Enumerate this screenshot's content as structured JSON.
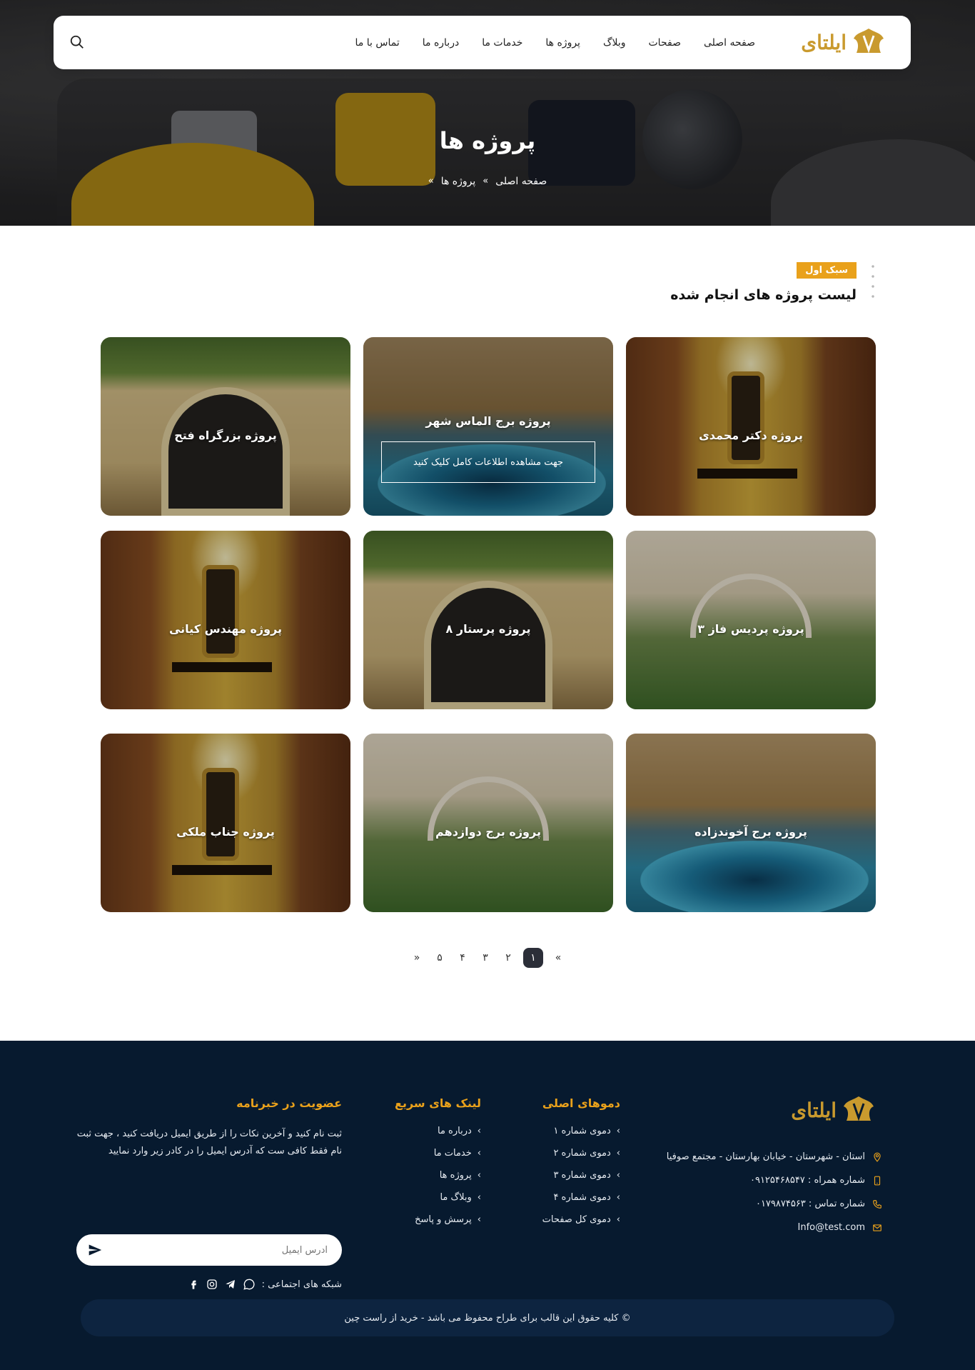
{
  "nav": {
    "logo_text": "ایلتای",
    "menu": [
      "صفحه اصلی",
      "صفحات",
      "وبلاگ",
      "پروژه ها",
      "خدمات ما",
      "درباره ما",
      "تماس با ما"
    ]
  },
  "hero": {
    "title": "پروژه ها",
    "breadcrumb": [
      "صفحه اصلی",
      "پروژه ها"
    ],
    "sep": "»"
  },
  "section": {
    "badge": "سبک اول",
    "title": "لیست پروژه های انجام شده"
  },
  "projects": [
    {
      "title": "پروژه دکتر محمدی",
      "scene": "mirror"
    },
    {
      "title": "پروژه برج الماس شهر",
      "scene": "pool",
      "button": "جهت مشاهده اطلاعات کامل کلیک کنید"
    },
    {
      "title": "پروژه بزرگراه فتح",
      "scene": "gate"
    },
    {
      "title": "پروژه پردیس فاز ۳",
      "scene": "garden"
    },
    {
      "title": "پروژه پرستار ۸",
      "scene": "gate"
    },
    {
      "title": "پروژه مهندس کیانی",
      "scene": "mirror"
    },
    {
      "title": "پروژه برج آخوندزاده",
      "scene": "pool"
    },
    {
      "title": "پروژه برج دوازدهم",
      "scene": "garden"
    },
    {
      "title": "پروژه جناب ملکی",
      "scene": "mirror"
    }
  ],
  "pagination": {
    "prev": "«",
    "pages": [
      "۱",
      "۲",
      "۳",
      "۴",
      "۵"
    ],
    "next": "»",
    "current": "۱"
  },
  "footer": {
    "logo_text": "ایلتای",
    "address": "استان - شهرستان - خیابان بهارستان - مجتمع صوفیا",
    "mobile": "شماره همراه : ۰۹۱۲۵۴۶۸۵۴۷",
    "phone": "شماره تماس : ۰۱۷۹۸۷۴۵۶۳",
    "email": "Info@test.com",
    "demos": {
      "title": "دموهای اصلی",
      "items": [
        "دموی شماره ۱",
        "دموی شماره ۲",
        "دموی شماره ۳",
        "دموی شماره ۴",
        "دموی کل صفحات"
      ]
    },
    "quick_links": {
      "title": "لینک های سریع",
      "items": [
        "درباره ما",
        "خدمات ما",
        "پروژه ها",
        "وبلاگ ما",
        "پرسش و پاسخ"
      ]
    },
    "newsletter": {
      "title": "عضویت در خبرنامه",
      "text": "ثبت نام کنید و آخرین نکات را از طریق ایمیل دریافت کنید ، جهت ثبت نام فقط کافی ست که آدرس ایمیل را در کادر زیر وارد نمایید",
      "placeholder": "آدرس ایمیل"
    },
    "social_label": "شبکه های اجتماعی :",
    "copyright": "© کلیه حقوق این قالب برای طراح محفوظ می باشد -  خرید از راست چین"
  }
}
